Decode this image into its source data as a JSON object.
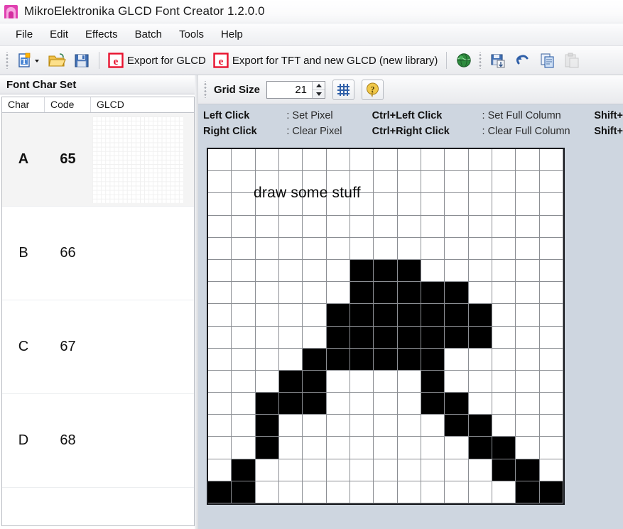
{
  "window": {
    "title": "MikroElektronika GLCD Font Creator 1.2.0.0",
    "app_icon": "app-logo-icon"
  },
  "menu": {
    "items": [
      {
        "label": "File"
      },
      {
        "label": "Edit"
      },
      {
        "label": "Effects"
      },
      {
        "label": "Batch"
      },
      {
        "label": "Tools"
      },
      {
        "label": "Help"
      }
    ]
  },
  "toolbar": {
    "buttons": [
      {
        "icon": "new-font-icon",
        "label": ""
      },
      {
        "icon": "open-folder-icon",
        "label": ""
      },
      {
        "icon": "save-disk-icon",
        "label": ""
      },
      {
        "icon": "export-glcd-icon",
        "label": "Export for GLCD"
      },
      {
        "icon": "export-tft-icon",
        "label": "Export for TFT and new GLCD (new library)"
      },
      {
        "icon": "globe-icon",
        "label": ""
      },
      {
        "icon": "save-as-icon",
        "label": ""
      },
      {
        "icon": "undo-icon",
        "label": ""
      },
      {
        "icon": "copy-icon",
        "label": ""
      },
      {
        "icon": "paste-icon",
        "label": ""
      }
    ]
  },
  "left_panel": {
    "header": "Font Char Set",
    "columns": [
      "Char",
      "Code",
      "GLCD"
    ],
    "rows": [
      {
        "char": "A",
        "code": "65",
        "selected": true
      },
      {
        "char": "B",
        "code": "66",
        "selected": false
      },
      {
        "char": "C",
        "code": "67",
        "selected": false
      },
      {
        "char": "D",
        "code": "68",
        "selected": false
      }
    ]
  },
  "grid_toolbar": {
    "grid_size_label": "Grid Size",
    "grid_size_value": "21",
    "grid_toggle_icon": "grid-icon",
    "help_icon": "help-question-icon"
  },
  "legend": {
    "rows": [
      {
        "c1_key": "Left Click",
        "c1_val": ": Set Pixel",
        "c2_key": "Ctrl+Left Click",
        "c2_val": ": Set Full Column",
        "c3_key": "Shift+"
      },
      {
        "c1_key": "Right Click",
        "c1_val": ": Clear Pixel",
        "c2_key": "Ctrl+Right Click",
        "c2_val": ": Clear Full Column",
        "c3_key": "Shift+"
      }
    ]
  },
  "canvas": {
    "overlay_text": "draw some stuff",
    "cols": 15,
    "rows": 15,
    "on_color": "#000000",
    "off_color": "#ffffff",
    "pixels": [
      [
        0,
        0,
        0,
        0,
        0,
        0,
        0,
        0,
        0,
        0,
        0,
        0,
        0,
        0,
        0
      ],
      [
        0,
        0,
        0,
        0,
        0,
        0,
        0,
        0,
        0,
        0,
        0,
        0,
        0,
        0,
        0
      ],
      [
        0,
        0,
        0,
        0,
        0,
        0,
        0,
        0,
        0,
        0,
        0,
        0,
        0,
        0,
        0
      ],
      [
        0,
        0,
        0,
        0,
        0,
        0,
        0,
        0,
        0,
        0,
        0,
        0,
        0,
        0,
        0
      ],
      [
        0,
        0,
        0,
        0,
        0,
        0,
        0,
        0,
        0,
        0,
        0,
        0,
        0,
        0,
        0
      ],
      [
        0,
        0,
        0,
        0,
        0,
        0,
        1,
        1,
        1,
        0,
        0,
        0,
        0,
        0,
        0
      ],
      [
        0,
        0,
        0,
        0,
        0,
        0,
        1,
        1,
        1,
        1,
        1,
        0,
        0,
        0,
        0
      ],
      [
        0,
        0,
        0,
        0,
        0,
        1,
        1,
        1,
        1,
        1,
        1,
        1,
        0,
        0,
        0
      ],
      [
        0,
        0,
        0,
        0,
        0,
        1,
        1,
        1,
        1,
        1,
        1,
        1,
        0,
        0,
        0
      ],
      [
        0,
        0,
        0,
        0,
        1,
        1,
        1,
        1,
        1,
        1,
        0,
        0,
        0,
        0,
        0
      ],
      [
        0,
        0,
        0,
        1,
        1,
        0,
        0,
        0,
        0,
        1,
        0,
        0,
        0,
        0,
        0
      ],
      [
        0,
        0,
        1,
        1,
        1,
        0,
        0,
        0,
        0,
        1,
        1,
        0,
        0,
        0,
        0
      ],
      [
        0,
        0,
        1,
        0,
        0,
        0,
        0,
        0,
        0,
        0,
        1,
        1,
        0,
        0,
        0
      ],
      [
        0,
        0,
        1,
        0,
        0,
        0,
        0,
        0,
        0,
        0,
        0,
        1,
        1,
        0,
        0
      ],
      [
        0,
        1,
        0,
        0,
        0,
        0,
        0,
        0,
        0,
        0,
        0,
        0,
        1,
        1,
        0
      ],
      [
        1,
        1,
        0,
        0,
        0,
        0,
        0,
        0,
        0,
        0,
        0,
        0,
        0,
        1,
        1
      ]
    ]
  },
  "colors": {
    "titlebar": "#ffffff",
    "toolbar": "#f2f3f5",
    "panel_bg": "#ced6e0",
    "accent_red": "#e8112d",
    "accent_blue": "#2f5fa8",
    "app_icon": "#e040b0"
  }
}
